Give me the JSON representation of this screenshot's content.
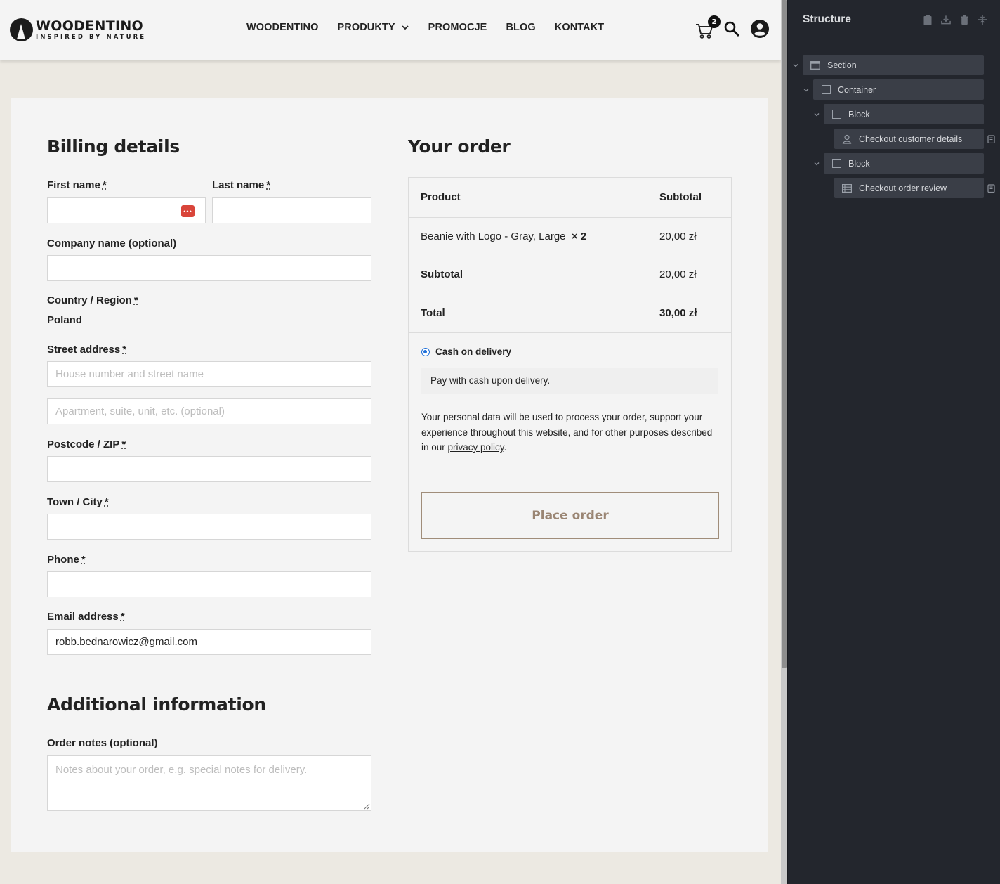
{
  "header": {
    "logo": {
      "name": "WOODENTINO",
      "tagline": "INSPIRED BY NATURE"
    },
    "nav": [
      "WOODENTINO",
      "PRODUKTY",
      "PROMOCJE",
      "BLOG",
      "KONTAKT"
    ],
    "cart_count": "2",
    "icons": [
      "cart-icon",
      "search-icon",
      "account-icon"
    ]
  },
  "billing": {
    "title": "Billing details",
    "required_marker": "*",
    "first_name": {
      "label": "First name",
      "value": ""
    },
    "last_name": {
      "label": "Last name",
      "value": ""
    },
    "company": {
      "label": "Company name (optional)",
      "value": ""
    },
    "country": {
      "label": "Country / Region",
      "value": "Poland"
    },
    "street": {
      "label": "Street address",
      "placeholder1": "House number and street name",
      "placeholder2": "Apartment, suite, unit, etc. (optional)"
    },
    "postcode": {
      "label": "Postcode / ZIP",
      "value": ""
    },
    "city": {
      "label": "Town / City",
      "value": ""
    },
    "phone": {
      "label": "Phone",
      "value": ""
    },
    "email": {
      "label": "Email address",
      "value": "robb.bednarowicz@gmail.com"
    }
  },
  "additional": {
    "title": "Additional information",
    "notes_label": "Order notes (optional)",
    "notes_placeholder": "Notes about your order, e.g. special notes for delivery."
  },
  "order": {
    "title": "Your order",
    "col_product": "Product",
    "col_subtotal": "Subtotal",
    "item": {
      "name": "Beanie with Logo - Gray, Large",
      "qty": "× 2",
      "price": "20,00 zł"
    },
    "subtotal_label": "Subtotal",
    "subtotal_value": "20,00 zł",
    "total_label": "Total",
    "total_value": "30,00 zł",
    "payment_method": "Cash on delivery",
    "payment_description": "Pay with cash upon delivery.",
    "privacy_text": "Your personal data will be used to process your order, support your experience throughout this website, and for other purposes described in our ",
    "privacy_link": "privacy policy",
    "privacy_end": ".",
    "place_order": "Place order"
  },
  "structure_panel": {
    "title": "Structure",
    "tools": [
      "clipboard-icon",
      "download-icon",
      "trash-icon",
      "collapse-icon"
    ],
    "tree": [
      {
        "label": "Section",
        "icon": "section-icon"
      },
      {
        "label": "Container",
        "icon": "container-icon"
      },
      {
        "label": "Block",
        "icon": "block-icon"
      },
      {
        "label": "Checkout customer details",
        "icon": "person-icon"
      },
      {
        "label": "Block",
        "icon": "block-icon"
      },
      {
        "label": "Checkout order review",
        "icon": "list-icon"
      }
    ]
  },
  "colors": {
    "accent": "#1e6fd9",
    "button_border": "#a08d7a",
    "button_text": "#9a8573",
    "page_bg": "#ece9e2",
    "panel_bg": "#23262d"
  }
}
